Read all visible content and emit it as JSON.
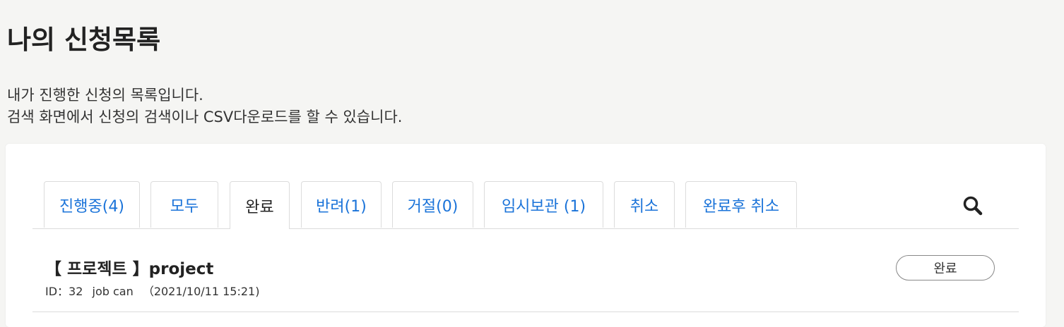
{
  "page": {
    "title": "나의 신청목록",
    "description": [
      "내가 진행한 신청의 목록입니다.",
      "검색 화면에서 신청의 검색이나 CSV다운로드를 할 수 있습니다."
    ]
  },
  "tabs": [
    {
      "label": "진행중(4)",
      "active": false
    },
    {
      "label": "모두",
      "active": false
    },
    {
      "label": "완료",
      "active": true
    },
    {
      "label": "반려(1)",
      "active": false
    },
    {
      "label": "거절(0)",
      "active": false
    },
    {
      "label": "임시보관 (1)",
      "active": false
    },
    {
      "label": "취소",
      "active": false
    },
    {
      "label": "완료후 취소",
      "active": false
    }
  ],
  "search": {
    "icon": "search-icon"
  },
  "colors": {
    "tab_link": "#1a73d9",
    "background": "#f5f5f3",
    "panel": "#ffffff"
  },
  "requests": [
    {
      "title": "【 프로젝트 】project",
      "id": "ID：32",
      "user": "job can",
      "date": "（2021/10/11 15:21)",
      "status": "완료"
    }
  ]
}
